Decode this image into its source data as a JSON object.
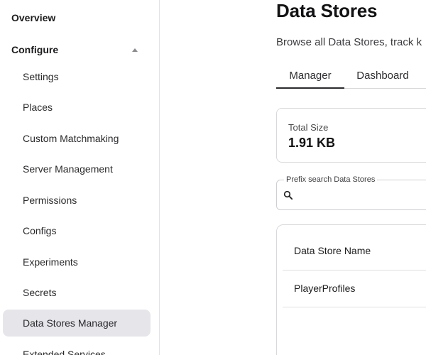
{
  "sidebar": {
    "overview": "Overview",
    "configure": "Configure",
    "items": [
      {
        "label": "Settings"
      },
      {
        "label": "Places"
      },
      {
        "label": "Custom Matchmaking"
      },
      {
        "label": "Server Management"
      },
      {
        "label": "Permissions"
      },
      {
        "label": "Configs"
      },
      {
        "label": "Experiments"
      },
      {
        "label": "Secrets"
      },
      {
        "label": "Data Stores Manager",
        "active": true
      },
      {
        "label": "Extended Services"
      }
    ]
  },
  "main": {
    "title": "Data Stores",
    "subtitle": "Browse all Data Stores, track k",
    "tabs": [
      {
        "label": "Manager",
        "active": true
      },
      {
        "label": "Dashboard"
      }
    ],
    "stats": {
      "total_size_label": "Total Size",
      "total_size_value": "1.91 KB"
    },
    "search": {
      "label": "Prefix search Data Stores",
      "value": "",
      "icon": "search-icon"
    },
    "table": {
      "header": "Data Store Name",
      "rows": [
        "PlayerProfiles"
      ]
    }
  }
}
